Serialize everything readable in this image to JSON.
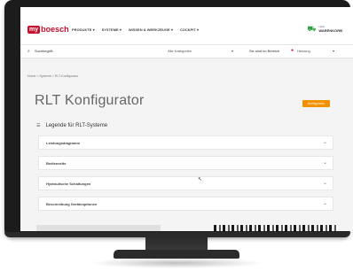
{
  "header": {
    "logo_badge": "my",
    "logo_text": "boesch",
    "nav": [
      "PRODUKTE",
      "SYSTEME",
      "WISSEN & WERKZEUGE",
      "COCKPIT"
    ],
    "user_small": "Hallo",
    "user_name": "WARENKORB"
  },
  "search": {
    "placeholder": "Suchbegriff...",
    "category": "Alle Kategorien",
    "area_label": "Sie sind im Bereich",
    "area_value": "Heizung"
  },
  "breadcrumb": "Home > Systeme > RLT-Konfigurator",
  "page_title": "RLT Konfigurator",
  "orange_button": "Konfigurator",
  "legend_title": "Legende für RLT-Systeme",
  "accordion": [
    {
      "label": "Leistungsdiagramm"
    },
    {
      "label": "Bedienseite"
    },
    {
      "label": "Hydraulische Schaltungen"
    },
    {
      "label": "Beschreibung Geräteoptionen"
    }
  ],
  "colors": {
    "brand": "#c8102e",
    "accent": "#f29100"
  },
  "icons": {
    "search": "search-icon",
    "pin": "location-pin-icon",
    "chevron": "chevron-down-icon",
    "legend": "list-icon",
    "cart": "truck-icon"
  }
}
